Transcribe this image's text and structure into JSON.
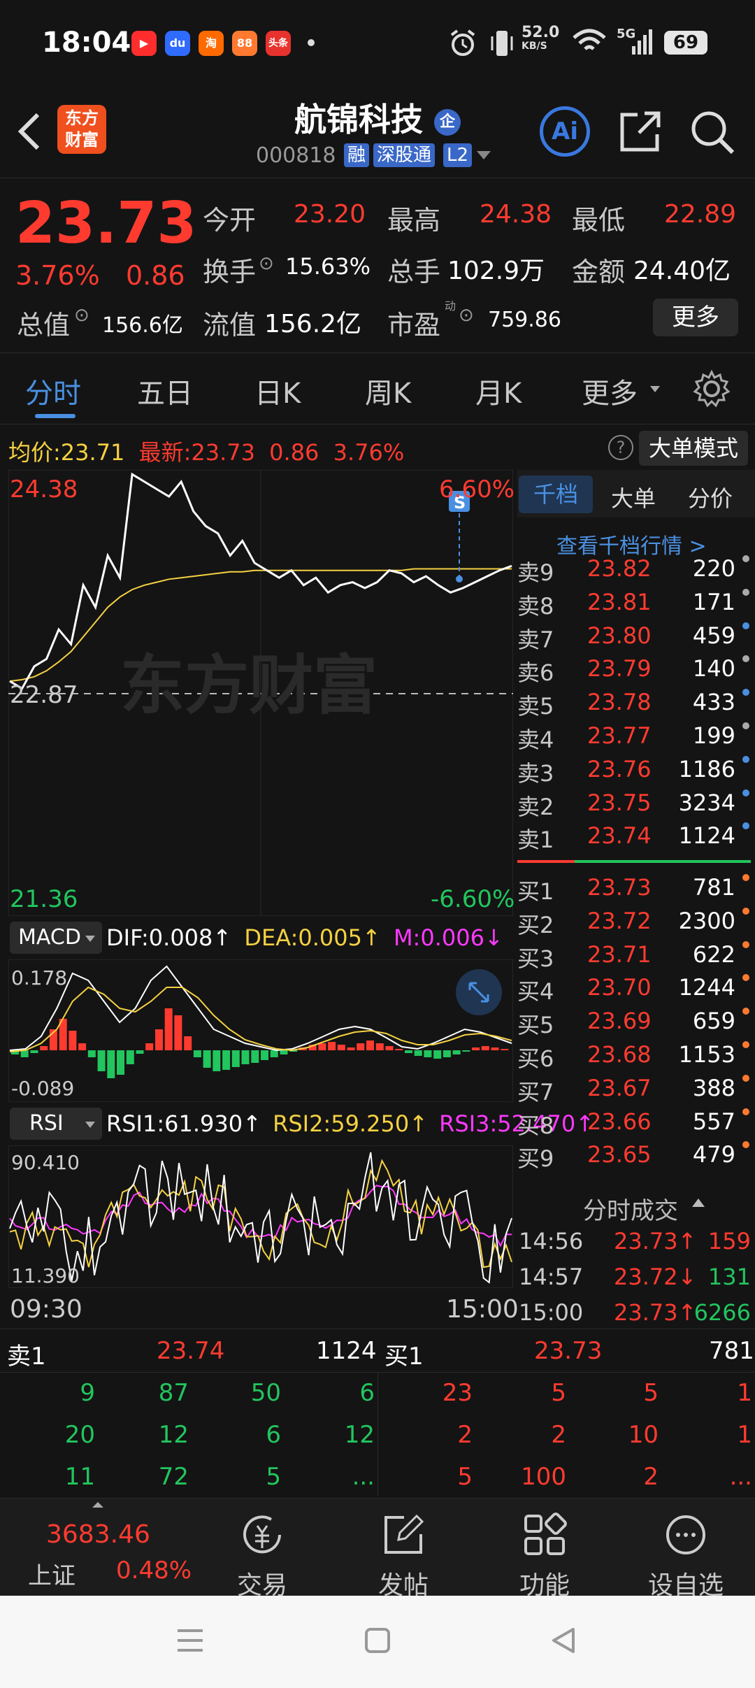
{
  "status_bar": {
    "time": "18:04",
    "net_speed": "52.0",
    "net_unit": "KB/S",
    "signal": "5G",
    "battery": "69",
    "apps": [
      "video-app-icon",
      "baidu-app-icon",
      "taobao-app-icon",
      "app4-icon",
      "toutiao-app-icon"
    ],
    "app_labels": [
      "▶",
      "du",
      "淘",
      "88",
      "头条"
    ]
  },
  "header": {
    "logo_line1": "东方",
    "logo_line2": "财富",
    "stock_name": "航锦科技",
    "enterprise_badge": "企",
    "stock_code": "000818",
    "tags": [
      "融",
      "深股通",
      "L2"
    ],
    "ai_label": "Ai"
  },
  "quote": {
    "price": "23.73",
    "change_pct": "3.76%",
    "change": "0.86",
    "open_label": "今开",
    "open": "23.20",
    "high_label": "最高",
    "high": "24.38",
    "low_label": "最低",
    "low": "22.89",
    "turnover_label": "换手",
    "turnover": "15.63%",
    "volume_label": "总手",
    "volume": "102.9万",
    "amount_label": "金额",
    "amount": "24.40亿",
    "mcap_label": "总值",
    "mcap": "156.6亿",
    "float_label": "流值",
    "float": "156.2亿",
    "pe_label": "市盈",
    "pe_sup": "动",
    "pe": "759.86",
    "more_button": "更多"
  },
  "tabs": [
    "分时",
    "五日",
    "日K",
    "周K",
    "月K",
    "更多"
  ],
  "chart_info": {
    "avg_label": "均价:",
    "avg": "23.71",
    "latest_label": "最新:",
    "latest": "23.73",
    "chg": "0.86",
    "chg_pct": "3.76%",
    "mode_button": "大单模式"
  },
  "chart_data": {
    "type": "line",
    "y_max_label": "24.38",
    "y_max_pct": "6.60%",
    "y_mid_label": "22.87",
    "y_min_label": "21.36",
    "y_min_pct": "-6.60%",
    "x_start": "09:30",
    "x_end": "15:00",
    "watermark": "东方财富",
    "signal_marker": "S",
    "series": [
      {
        "name": "price",
        "color": "#ffffff",
        "values": [
          22.95,
          22.9,
          23.05,
          23.1,
          23.3,
          23.2,
          23.6,
          23.45,
          23.8,
          23.65,
          24.35,
          24.3,
          24.25,
          24.2,
          24.3,
          24.1,
          24.0,
          23.95,
          23.8,
          23.9,
          23.75,
          23.7,
          23.65,
          23.7,
          23.6,
          23.65,
          23.55,
          23.6,
          23.62,
          23.58,
          23.62,
          23.7,
          23.68,
          23.62,
          23.66,
          23.6,
          23.55,
          23.58,
          23.62,
          23.66,
          23.7,
          23.73
        ]
      },
      {
        "name": "avg",
        "color": "#f5d142",
        "values": [
          22.95,
          22.96,
          22.98,
          23.02,
          23.08,
          23.15,
          23.25,
          23.35,
          23.45,
          23.52,
          23.57,
          23.6,
          23.62,
          23.64,
          23.65,
          23.66,
          23.67,
          23.68,
          23.69,
          23.69,
          23.7,
          23.7,
          23.7,
          23.7,
          23.7,
          23.7,
          23.7,
          23.7,
          23.7,
          23.7,
          23.7,
          23.7,
          23.7,
          23.71,
          23.71,
          23.71,
          23.71,
          23.71,
          23.71,
          23.71,
          23.71,
          23.71
        ]
      }
    ],
    "ylim": [
      21.36,
      24.38
    ]
  },
  "macd": {
    "label": "MACD",
    "dif": "DIF:0.008↑",
    "dea": "DEA:0.005↑",
    "m": "M:0.006↓",
    "y_top": "0.178",
    "y_bot": "-0.089"
  },
  "rsi": {
    "label": "RSI",
    "rsi1": "RSI1:61.930↑",
    "rsi2": "RSI2:59.250↑",
    "rsi3": "RSI3:52.470↑",
    "y_top": "90.410",
    "y_bot": "11.390"
  },
  "orderbook": {
    "tabs": [
      "千档",
      "大单",
      "分价"
    ],
    "view_link": "查看千档行情 >",
    "asks": [
      {
        "label": "卖9",
        "price": "23.82",
        "vol": "220",
        "dot": "#aaaaaa"
      },
      {
        "label": "卖8",
        "price": "23.81",
        "vol": "171",
        "dot": "#aaaaaa"
      },
      {
        "label": "卖7",
        "price": "23.80",
        "vol": "459",
        "dot": "#4a90e2"
      },
      {
        "label": "卖6",
        "price": "23.79",
        "vol": "140",
        "dot": "#aaaaaa"
      },
      {
        "label": "卖5",
        "price": "23.78",
        "vol": "433",
        "dot": "#4a90e2"
      },
      {
        "label": "卖4",
        "price": "23.77",
        "vol": "199",
        "dot": "#aaaaaa"
      },
      {
        "label": "卖3",
        "price": "23.76",
        "vol": "1186",
        "dot": "#4a90e2"
      },
      {
        "label": "卖2",
        "price": "23.75",
        "vol": "3234",
        "dot": "#4a90e2"
      },
      {
        "label": "卖1",
        "price": "23.74",
        "vol": "1124",
        "dot": "#4a90e2"
      }
    ],
    "bids": [
      {
        "label": "买1",
        "price": "23.73",
        "vol": "781",
        "dot": "#ff7a30"
      },
      {
        "label": "买2",
        "price": "23.72",
        "vol": "2300",
        "dot": "#ff7a30"
      },
      {
        "label": "买3",
        "price": "23.71",
        "vol": "622",
        "dot": "#ff7a30"
      },
      {
        "label": "买4",
        "price": "23.70",
        "vol": "1244",
        "dot": "#ff7a30"
      },
      {
        "label": "买5",
        "price": "23.69",
        "vol": "659",
        "dot": "#ff7a30"
      },
      {
        "label": "买6",
        "price": "23.68",
        "vol": "1153",
        "dot": "#ff7a30"
      },
      {
        "label": "买7",
        "price": "23.67",
        "vol": "388",
        "dot": "#ff7a30"
      },
      {
        "label": "买8",
        "price": "23.66",
        "vol": "557",
        "dot": "#ff7a30"
      },
      {
        "label": "买9",
        "price": "23.65",
        "vol": "479",
        "dot": "#ff7a30"
      }
    ],
    "ticks_title": "分时成交",
    "ticks": [
      {
        "time": "14:56",
        "price": "23.73↑",
        "vol": "159",
        "vol_color": "#ff3b30"
      },
      {
        "time": "14:57",
        "price": "23.72↓",
        "vol": "131",
        "vol_color": "#22c55e"
      },
      {
        "time": "15:00",
        "price": "23.73↑",
        "vol": "6266",
        "vol_color": "#22c55e"
      }
    ]
  },
  "depth": {
    "sell_label": "卖1",
    "sell_price": "23.74",
    "sell_vol": "1124",
    "buy_label": "买1",
    "buy_price": "23.73",
    "buy_vol": "781",
    "sell_grid": [
      [
        "9",
        "87",
        "50",
        "6"
      ],
      [
        "20",
        "12",
        "6",
        "12"
      ],
      [
        "11",
        "72",
        "5",
        "..."
      ]
    ],
    "buy_grid": [
      [
        "23",
        "5",
        "5",
        "1"
      ],
      [
        "2",
        "2",
        "10",
        "1"
      ],
      [
        "5",
        "100",
        "2",
        "..."
      ]
    ]
  },
  "bottom_nav": {
    "index_value": "3683.46",
    "index_name": "上证",
    "index_pct": "0.48%",
    "items": [
      "交易",
      "发帖",
      "功能",
      "设自选"
    ]
  }
}
